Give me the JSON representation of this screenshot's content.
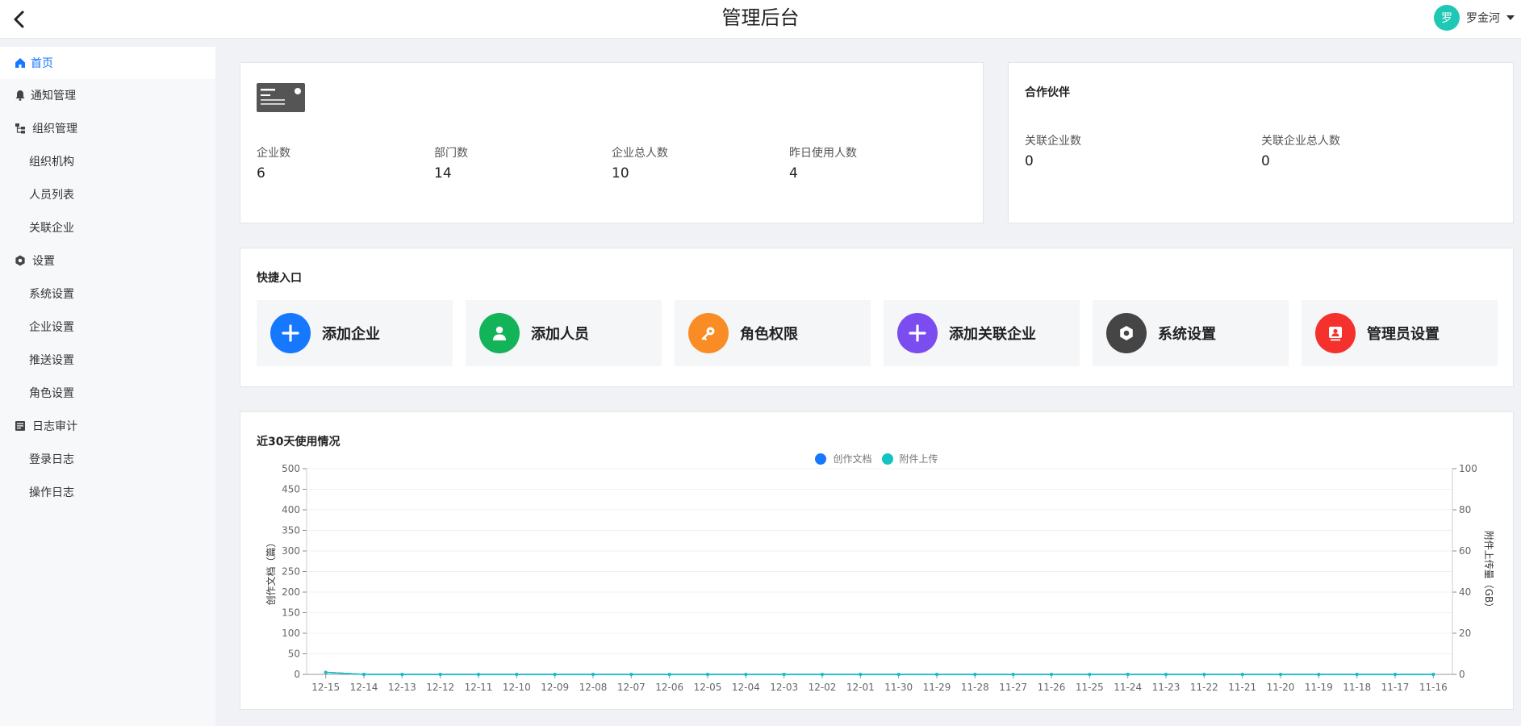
{
  "header": {
    "title": "管理后台",
    "user": {
      "avatar_text": "罗",
      "name": "罗金河"
    }
  },
  "sidebar": {
    "home": "首页",
    "notify": "通知管理",
    "org": {
      "label": "组织管理",
      "items": [
        "组织机构",
        "人员列表",
        "关联企业"
      ]
    },
    "settings": {
      "label": "设置",
      "items": [
        "系统设置",
        "企业设置",
        "推送设置",
        "角色设置"
      ]
    },
    "logs": {
      "label": "日志审计",
      "items": [
        "登录日志",
        "操作日志"
      ]
    }
  },
  "stats": [
    {
      "label": "企业数",
      "value": "6"
    },
    {
      "label": "部门数",
      "value": "14"
    },
    {
      "label": "企业总人数",
      "value": "10"
    },
    {
      "label": "昨日使用人数",
      "value": "4"
    }
  ],
  "partners": {
    "title": "合作伙伴",
    "stats": [
      {
        "label": "关联企业数",
        "value": "0"
      },
      {
        "label": "关联企业总人数",
        "value": "0"
      }
    ]
  },
  "quick": {
    "title": "快捷入口",
    "items": [
      {
        "label": "添加企业",
        "icon": "plus-icon",
        "color": "#1677ff"
      },
      {
        "label": "添加人员",
        "icon": "user-icon",
        "color": "#13b35a"
      },
      {
        "label": "角色权限",
        "icon": "key-icon",
        "color": "#fa8c26"
      },
      {
        "label": "添加关联企业",
        "icon": "plus-icon",
        "color": "#7b4cf0"
      },
      {
        "label": "系统设置",
        "icon": "gear-icon",
        "color": "#454545"
      },
      {
        "label": "管理员设置",
        "icon": "admin-icon",
        "color": "#f5312e"
      }
    ]
  },
  "usage": {
    "title": "近30天使用情况"
  },
  "chart_data": {
    "type": "line",
    "title": "近30天使用情况",
    "categories": [
      "12-15",
      "12-14",
      "12-13",
      "12-12",
      "12-11",
      "12-10",
      "12-09",
      "12-08",
      "12-07",
      "12-06",
      "12-05",
      "12-04",
      "12-03",
      "12-02",
      "12-01",
      "11-30",
      "11-29",
      "11-28",
      "11-27",
      "11-26",
      "11-25",
      "11-24",
      "11-23",
      "11-22",
      "11-21",
      "11-20",
      "11-19",
      "11-18",
      "11-17",
      "11-16"
    ],
    "series": [
      {
        "name": "创作文档",
        "axis": "left",
        "color": "#1677ff",
        "values": [
          5,
          0,
          0,
          0,
          0,
          0,
          0,
          0,
          0,
          0,
          0,
          0,
          0,
          0,
          0,
          0,
          0,
          0,
          0,
          0,
          0,
          0,
          0,
          0,
          0,
          0,
          0,
          0,
          0,
          0
        ]
      },
      {
        "name": "附件上传",
        "axis": "right",
        "color": "#13c2c2",
        "values": [
          1,
          0,
          0,
          0,
          0,
          0,
          0,
          0,
          0,
          0,
          0,
          0,
          0,
          0,
          0,
          0,
          0,
          0,
          0,
          0,
          0,
          0,
          0,
          0,
          0,
          0,
          0,
          0,
          0,
          0
        ]
      }
    ],
    "ylabel": "创作文档（篇）",
    "ylabel_right": "附件上传量（GB）",
    "ylim": [
      0,
      500
    ],
    "ylim_right": [
      0,
      100
    ],
    "yticks": [
      0,
      50,
      100,
      150,
      200,
      250,
      300,
      350,
      400,
      450,
      500
    ],
    "yticks_right": [
      0,
      20,
      40,
      60,
      80,
      100
    ],
    "grid": true,
    "legend_position": "top-center"
  }
}
